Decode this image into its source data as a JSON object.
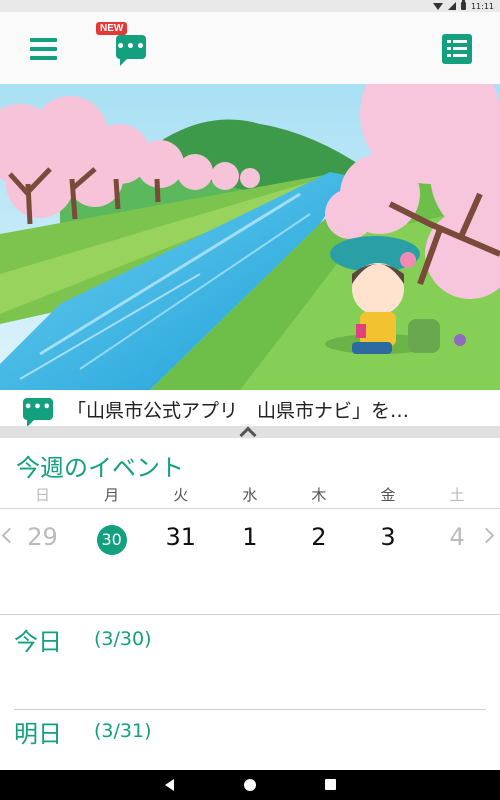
{
  "status_bar": {
    "time": "11:11"
  },
  "header": {
    "new_badge": "NEW",
    "colors": {
      "accent": "#12a07f",
      "badge": "#e53935"
    }
  },
  "news": {
    "text": "「山県市公式アプリ　山県市ナビ」を…"
  },
  "events": {
    "title": "今週のイベント",
    "weekdays": [
      "日",
      "月",
      "火",
      "水",
      "木",
      "金",
      "土"
    ],
    "dates": [
      "29",
      "30",
      "31",
      "1",
      "2",
      "3",
      "4"
    ],
    "today_index": 1
  },
  "days": [
    {
      "label": "今日",
      "date": "(3/30)"
    },
    {
      "label": "明日",
      "date": "(3/31)"
    }
  ]
}
